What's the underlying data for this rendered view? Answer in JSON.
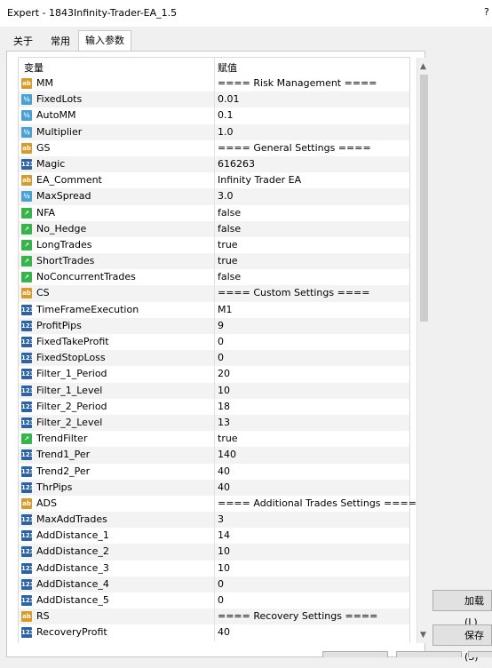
{
  "window": {
    "title": "Expert - 1843Infinity-Trader-EA_1.5",
    "help": "?"
  },
  "tabs": [
    {
      "label": "关于"
    },
    {
      "label": "常用"
    },
    {
      "label": "输入参数"
    }
  ],
  "grid": {
    "headers": {
      "variable": "变量",
      "value": "赋值"
    },
    "rows": [
      {
        "type": "ab",
        "name": "MM",
        "value": "==== Risk Management ===="
      },
      {
        "type": "v2",
        "name": "FixedLots",
        "value": "0.01"
      },
      {
        "type": "v2",
        "name": "AutoMM",
        "value": "0.1"
      },
      {
        "type": "v2",
        "name": "Multiplier",
        "value": "1.0"
      },
      {
        "type": "ab",
        "name": "GS",
        "value": "==== General Settings ===="
      },
      {
        "type": "n123",
        "name": "Magic",
        "value": "616263"
      },
      {
        "type": "ab",
        "name": "EA_Comment",
        "value": "Infinity Trader EA"
      },
      {
        "type": "v2",
        "name": "MaxSpread",
        "value": "3.0"
      },
      {
        "type": "bool",
        "name": "NFA",
        "value": "false"
      },
      {
        "type": "bool",
        "name": "No_Hedge",
        "value": "false"
      },
      {
        "type": "bool",
        "name": "LongTrades",
        "value": "true"
      },
      {
        "type": "bool",
        "name": "ShortTrades",
        "value": "true"
      },
      {
        "type": "bool",
        "name": "NoConcurrentTrades",
        "value": "false"
      },
      {
        "type": "ab",
        "name": "CS",
        "value": "==== Custom Settings ===="
      },
      {
        "type": "n123",
        "name": "TimeFrameExecution",
        "value": "M1"
      },
      {
        "type": "n123",
        "name": "ProfitPips",
        "value": "9"
      },
      {
        "type": "n123",
        "name": "FixedTakeProfit",
        "value": "0"
      },
      {
        "type": "n123",
        "name": "FixedStopLoss",
        "value": "0"
      },
      {
        "type": "n123",
        "name": "Filter_1_Period",
        "value": "20"
      },
      {
        "type": "n123",
        "name": "Filter_1_Level",
        "value": "10"
      },
      {
        "type": "n123",
        "name": "Filter_2_Period",
        "value": "18"
      },
      {
        "type": "n123",
        "name": "Filter_2_Level",
        "value": "13"
      },
      {
        "type": "bool",
        "name": "TrendFilter",
        "value": "true"
      },
      {
        "type": "n123",
        "name": "Trend1_Per",
        "value": "140"
      },
      {
        "type": "n123",
        "name": "Trend2_Per",
        "value": "40"
      },
      {
        "type": "n123",
        "name": "ThrPips",
        "value": "40"
      },
      {
        "type": "ab",
        "name": "ADS",
        "value": "==== Additional Trades Settings ===="
      },
      {
        "type": "n123",
        "name": "MaxAddTrades",
        "value": "3"
      },
      {
        "type": "n123",
        "name": "AddDistance_1",
        "value": "14"
      },
      {
        "type": "n123",
        "name": "AddDistance_2",
        "value": "10"
      },
      {
        "type": "n123",
        "name": "AddDistance_3",
        "value": "10"
      },
      {
        "type": "n123",
        "name": "AddDistance_4",
        "value": "0"
      },
      {
        "type": "n123",
        "name": "AddDistance_5",
        "value": "0"
      },
      {
        "type": "ab",
        "name": "RS",
        "value": "==== Recovery Settings ===="
      },
      {
        "type": "n123",
        "name": "RecoveryProfit",
        "value": "40"
      }
    ]
  },
  "icons": {
    "ab": {
      "name": "string-type-icon",
      "glyph": "ab"
    },
    "v2": {
      "name": "double-type-icon",
      "glyph": "½"
    },
    "n123": {
      "name": "integer-type-icon",
      "glyph": "123"
    },
    "bool": {
      "name": "bool-type-icon",
      "glyph": "↗"
    }
  },
  "buttons": {
    "load": "加载(L)",
    "save": "保存(S)"
  },
  "scroll": {
    "up": "▲",
    "down": "▼"
  }
}
